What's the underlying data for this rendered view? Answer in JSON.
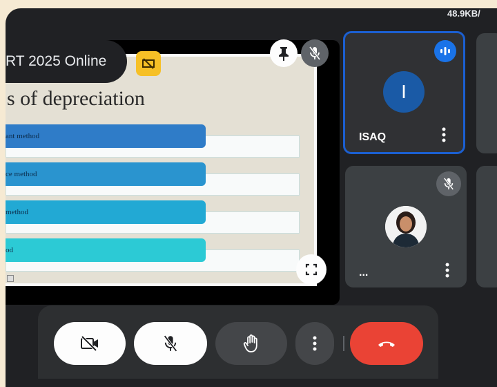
{
  "status_bar": {
    "net_speed": "48.9KB/"
  },
  "presentation": {
    "meeting_title": "RT 2025 Online",
    "slide": {
      "heading": "s of depreciation",
      "items": [
        {
          "label": "ant method",
          "color": "#2f7cc8"
        },
        {
          "label": "ce method",
          "color": "#2a94cf"
        },
        {
          "label": "method",
          "color": "#22a9d4"
        },
        {
          "label": "od",
          "color": "#2ccad5"
        }
      ]
    }
  },
  "participants": [
    {
      "initial": "I",
      "name": "ISAQ",
      "speaking": true
    },
    {
      "name": "...",
      "muted": true
    }
  ],
  "controls": {
    "camera": "camera-off-icon",
    "mic": "mic-off-icon",
    "hand": "raise-hand-icon",
    "more": "more-vert-icon",
    "end_call": "end-call-icon",
    "end_call_color": "#ea4335"
  }
}
